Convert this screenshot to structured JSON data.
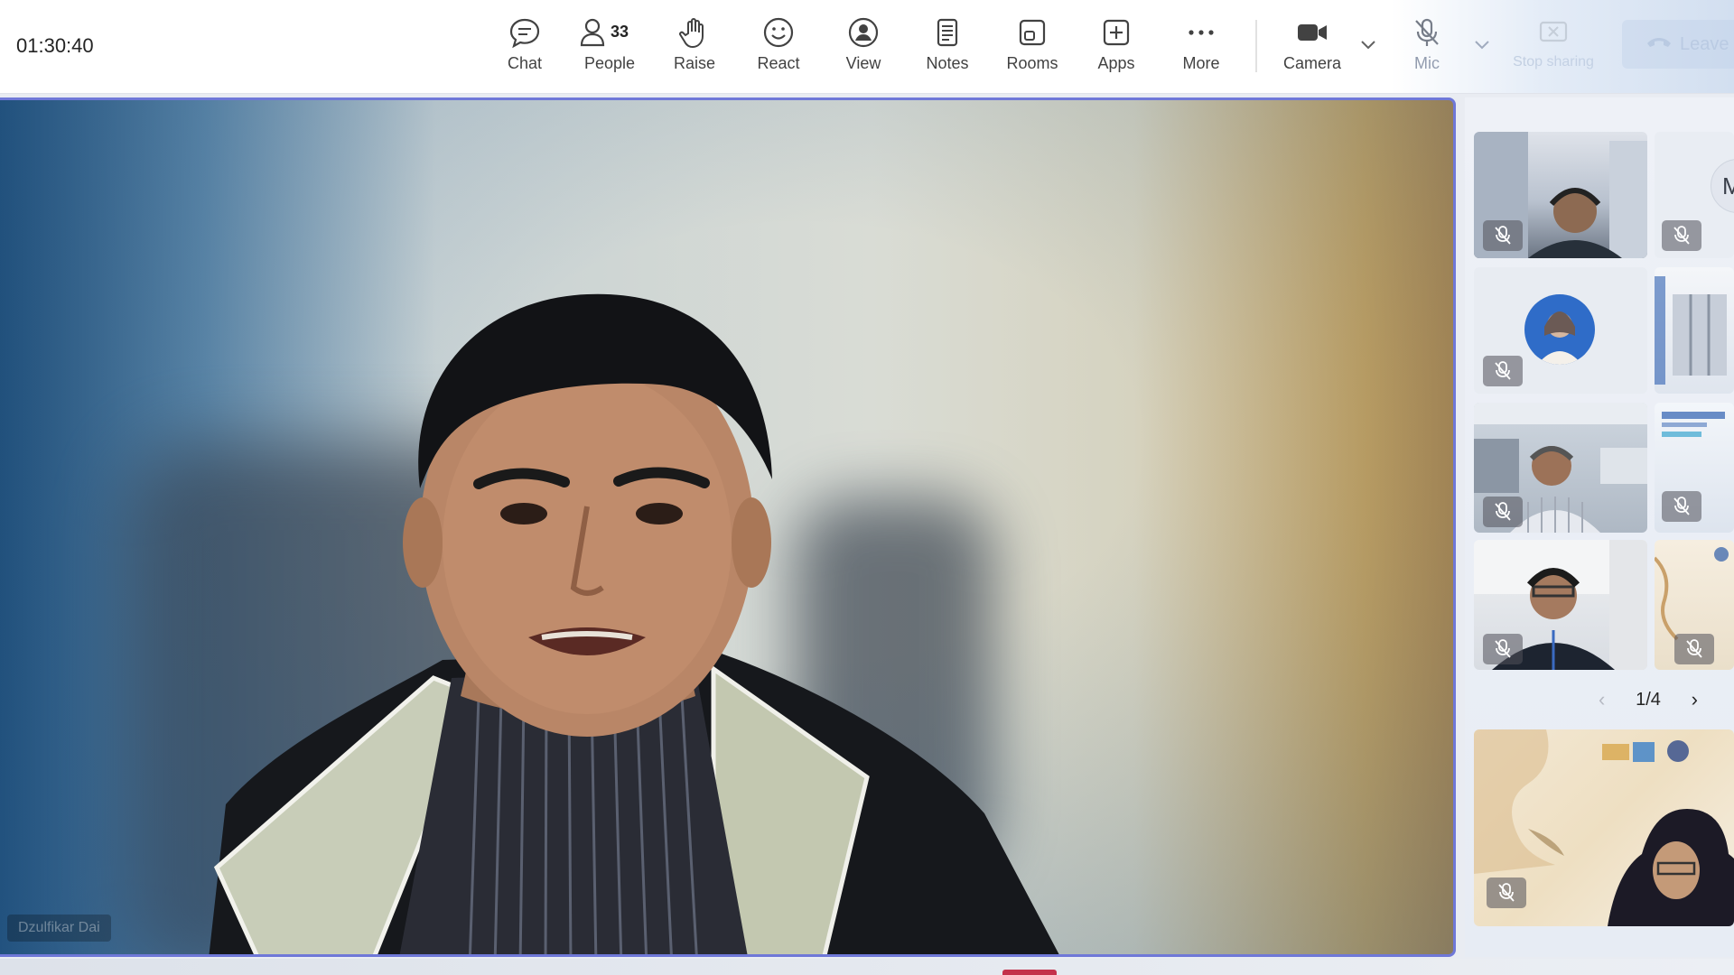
{
  "meeting": {
    "timer": "01:30:40"
  },
  "toolbar": {
    "chat_label": "Chat",
    "people_label": "People",
    "people_count": "33",
    "raise_label": "Raise",
    "react_label": "React",
    "view_label": "View",
    "notes_label": "Notes",
    "rooms_label": "Rooms",
    "apps_label": "Apps",
    "more_label": "More",
    "camera_label": "Camera",
    "mic_label": "Mic",
    "stop_sharing_label": "Stop sharing",
    "leave_label": "Leave"
  },
  "stage": {
    "speaker_name": "Dzulfikar Dai"
  },
  "gallery": {
    "pager": "1/4",
    "tile_initial": "M"
  },
  "colors": {
    "accent": "#6f78d8",
    "leave_bg": "#dfe6f2",
    "text": "#242424"
  }
}
